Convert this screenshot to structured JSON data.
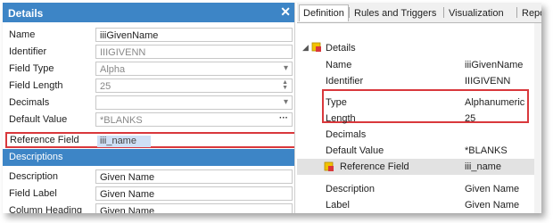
{
  "details_panel": {
    "title": "Details",
    "close_glyph": "✕",
    "fields": [
      {
        "label": "Name",
        "value": "iiiGivenName",
        "readonly": false
      },
      {
        "label": "Identifier",
        "value": "IIIGIVENN",
        "readonly": true
      },
      {
        "label": "Field Type",
        "value": "Alpha",
        "readonly": true,
        "control": "dropdown"
      },
      {
        "label": "Field Length",
        "value": "25",
        "readonly": true,
        "control": "spinner"
      },
      {
        "label": "Decimals",
        "value": "",
        "readonly": false,
        "control": "dropdown"
      },
      {
        "label": "Default Value",
        "value": "*BLANKS",
        "readonly": true,
        "control": "ellipsis"
      }
    ],
    "reference_field": {
      "label": "Reference Field",
      "value": "iii_name"
    },
    "descriptions_section": "Descriptions",
    "desc_fields": [
      {
        "label": "Description",
        "value": "Given Name"
      },
      {
        "label": "Field Label",
        "value": "Given Name"
      },
      {
        "label": "Column Heading",
        "value": "Given Name"
      }
    ],
    "highlight_color": "#d9383c",
    "accent": "#3d85c6"
  },
  "right_panel": {
    "tabs": [
      "Definition",
      "Rules and Triggers",
      "Visualization",
      "Repository Help"
    ],
    "active_tab": "Definition",
    "group_title": "Details",
    "rows": [
      {
        "key": "Name",
        "value": "iiiGivenName"
      },
      {
        "key": "Identifier",
        "value": "IIIGIVENN"
      },
      {
        "key": "Type",
        "value": "Alphanumeric"
      },
      {
        "key": "Length",
        "value": "25"
      },
      {
        "key": "Decimals",
        "value": ""
      },
      {
        "key": "Default Value",
        "value": "*BLANKS"
      },
      {
        "key": "Reference Field",
        "value": "iii_name"
      },
      {
        "key": "Description",
        "value": "Given Name"
      },
      {
        "key": "Label",
        "value": "Given Name"
      }
    ]
  }
}
